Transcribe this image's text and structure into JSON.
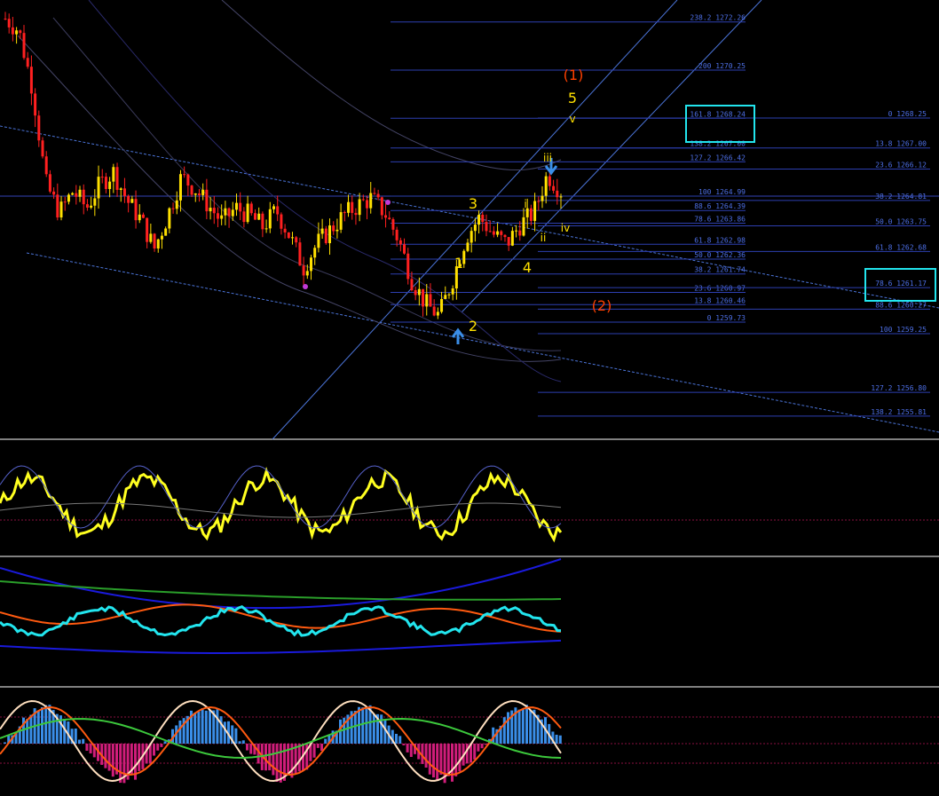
{
  "colors": {
    "background": "#000000",
    "fib_lines": "#2d3fb0",
    "fib_text": "#4d6fe6",
    "bull_candle": "#ffe000",
    "bear_candle": "#ff2020",
    "highlight_box": "#22e5ee",
    "wave_label": "#ffe000",
    "wave_label_major": "#ff4000",
    "oscillator": "#ffff20",
    "rsi_line": "#22e5ee",
    "macd_pos": "#3a8ee8",
    "macd_neg": "#d01d7a"
  },
  "chart_data": {
    "type": "line",
    "title": "",
    "xlabel": "",
    "ylabel": "",
    "ylim": [
      1255.3,
      1273.5
    ],
    "fib_left": [
      {
        "label": "238.2 1272.26",
        "value": 1272.26
      },
      {
        "label": "200 1270.25",
        "value": 1270.25
      },
      {
        "label": "161.8 1268.24",
        "value": 1268.24
      },
      {
        "label": "138.2 1267.00",
        "value": 1267.0
      },
      {
        "label": "127.2 1266.42",
        "value": 1266.42
      },
      {
        "label": "100 1264.99",
        "value": 1264.99
      },
      {
        "label": "88.6 1264.39",
        "value": 1264.39
      },
      {
        "label": "78.6 1263.86",
        "value": 1263.86
      },
      {
        "label": "61.8 1262.98",
        "value": 1262.98
      },
      {
        "label": "50.0 1262.36",
        "value": 1262.36
      },
      {
        "label": "38.2 1261.74",
        "value": 1261.74
      },
      {
        "label": "23.6 1260.97",
        "value": 1260.97
      },
      {
        "label": "13.8 1260.46",
        "value": 1260.46
      },
      {
        "label": "0 1259.73",
        "value": 1259.73
      }
    ],
    "fib_right": [
      {
        "label": "0 1268.25",
        "value": 1268.25
      },
      {
        "label": "13.8 1267.00",
        "value": 1267.0
      },
      {
        "label": "23.6 1266.12",
        "value": 1266.12
      },
      {
        "label": "38.2 1264.81",
        "value": 1264.81
      },
      {
        "label": "50.0 1263.75",
        "value": 1263.75
      },
      {
        "label": "61.8 1262.68",
        "value": 1262.68
      },
      {
        "label": "78.6 1261.17",
        "value": 1261.17
      },
      {
        "label": "88.6 1260.27",
        "value": 1260.27
      },
      {
        "label": "100 1259.25",
        "value": 1259.25
      },
      {
        "label": "127.2 1256.80",
        "value": 1256.8
      },
      {
        "label": "138.2 1255.81",
        "value": 1255.81
      }
    ],
    "price_series": [
      {
        "t": 0,
        "p": 1272.4
      },
      {
        "t": 1,
        "p": 1271.9
      },
      {
        "t": 2,
        "p": 1269.5
      },
      {
        "t": 3,
        "p": 1265.5
      },
      {
        "t": 4,
        "p": 1264.3
      },
      {
        "t": 5,
        "p": 1265.2
      },
      {
        "t": 6,
        "p": 1264.5
      },
      {
        "t": 7,
        "p": 1265.5
      },
      {
        "t": 8,
        "p": 1266.0
      },
      {
        "t": 9,
        "p": 1264.8
      },
      {
        "t": 10,
        "p": 1264.0
      },
      {
        "t": 11,
        "p": 1262.8
      },
      {
        "t": 12,
        "p": 1264.2
      },
      {
        "t": 13,
        "p": 1265.8
      },
      {
        "t": 14,
        "p": 1265.3
      },
      {
        "t": 15,
        "p": 1264.6
      },
      {
        "t": 16,
        "p": 1263.9
      },
      {
        "t": 17,
        "p": 1264.5
      },
      {
        "t": 18,
        "p": 1264.2
      },
      {
        "t": 19,
        "p": 1263.7
      },
      {
        "t": 20,
        "p": 1264.4
      },
      {
        "t": 21,
        "p": 1263.3
      },
      {
        "t": 22,
        "p": 1262.0
      },
      {
        "t": 23,
        "p": 1263.0
      },
      {
        "t": 24,
        "p": 1263.6
      },
      {
        "t": 25,
        "p": 1264.2
      },
      {
        "t": 26,
        "p": 1264.6
      },
      {
        "t": 27,
        "p": 1264.9
      },
      {
        "t": 28,
        "p": 1264.3
      },
      {
        "t": 29,
        "p": 1263.2
      },
      {
        "t": 30,
        "p": 1261.5
      },
      {
        "t": 31,
        "p": 1260.5
      },
      {
        "t": 32,
        "p": 1260.0
      },
      {
        "t": 33,
        "p": 1261.5
      },
      {
        "t": 34,
        "p": 1263.3
      },
      {
        "t": 35,
        "p": 1264.1
      },
      {
        "t": 36,
        "p": 1263.4
      },
      {
        "t": 37,
        "p": 1263.0
      },
      {
        "t": 38,
        "p": 1263.8
      },
      {
        "t": 39,
        "p": 1264.3
      },
      {
        "t": 40,
        "p": 1265.9
      },
      {
        "t": 41,
        "p": 1265.2
      }
    ],
    "wave_labels": [
      {
        "label": "(1)",
        "style": "major"
      },
      {
        "label": "5",
        "style": "wave"
      },
      {
        "label": "v",
        "style": "small"
      },
      {
        "label": "iii",
        "style": "small"
      },
      {
        "label": "3",
        "style": "wave"
      },
      {
        "label": "i",
        "style": "small"
      },
      {
        "label": "iv",
        "style": "small"
      },
      {
        "label": "ii",
        "style": "small"
      },
      {
        "label": "1",
        "style": "wave"
      },
      {
        "label": "4",
        "style": "wave"
      },
      {
        "label": "2",
        "style": "wave"
      },
      {
        "label": "(2)",
        "style": "major"
      }
    ],
    "grid": false,
    "legend": "none"
  }
}
